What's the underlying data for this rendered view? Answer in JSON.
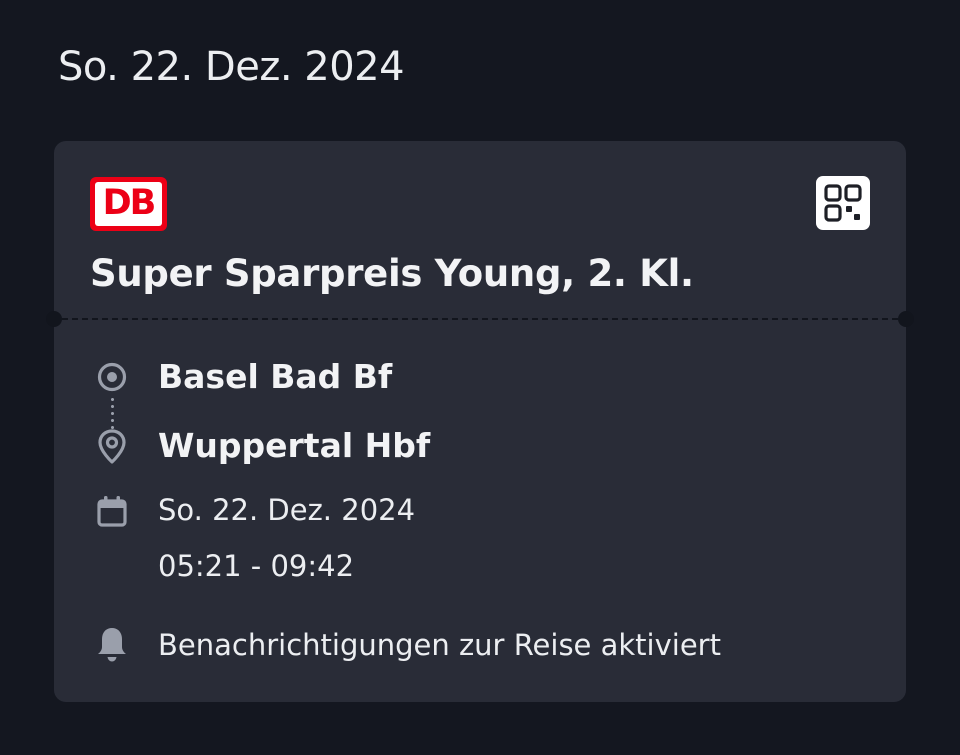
{
  "header": {
    "date": "So. 22. Dez. 2024"
  },
  "ticket": {
    "logo_text": "DB",
    "qr_icon": "qr-code-icon",
    "title": "Super Sparpreis Young, 2. Kl.",
    "origin": "Basel Bad Bf",
    "destination": "Wuppertal Hbf",
    "travel_date": "So. 22. Dez. 2024",
    "time_range": "05:21 - 09:42",
    "notification_text": "Benachrichtigungen zur Reise aktiviert",
    "icons": {
      "origin": "origin-circle-icon",
      "destination": "location-pin-icon",
      "date": "calendar-icon",
      "notification": "bell-icon"
    }
  },
  "colors": {
    "background": "#141720",
    "card": "#292c37",
    "brand_red": "#ec0016",
    "text": "#f2f3f5",
    "icon_gray": "#9a9fab"
  }
}
